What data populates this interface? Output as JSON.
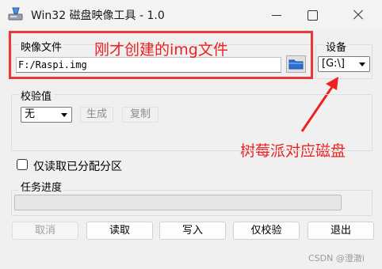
{
  "window": {
    "title": "Win32 磁盘映像工具 - 1.0"
  },
  "image_file": {
    "group_label": "映像文件",
    "path_value": "F:/Raspi.img"
  },
  "device": {
    "group_label": "设备",
    "selected": "[G:\\]"
  },
  "checksum": {
    "group_label": "校验值",
    "type_selected": "无",
    "generate_label": "生成",
    "copy_label": "复制"
  },
  "options": {
    "read_only_allocated_label": "仅读取已分配分区",
    "read_only_allocated_checked": false
  },
  "progress": {
    "group_label": "任务进度",
    "value_percent": 0
  },
  "actions": {
    "cancel_label": "取消",
    "read_label": "读取",
    "write_label": "写入",
    "verify_only_label": "仅校验",
    "exit_label": "退出"
  },
  "annotations": {
    "img_note": "刚才创建的img文件",
    "disk_note": "树莓派对应磁盘",
    "color": "#ee2020"
  },
  "watermark": "CSDN @澄澈i",
  "colors": {
    "accent_folder": "#2a6fd6",
    "annotation_red": "#e8393a"
  }
}
